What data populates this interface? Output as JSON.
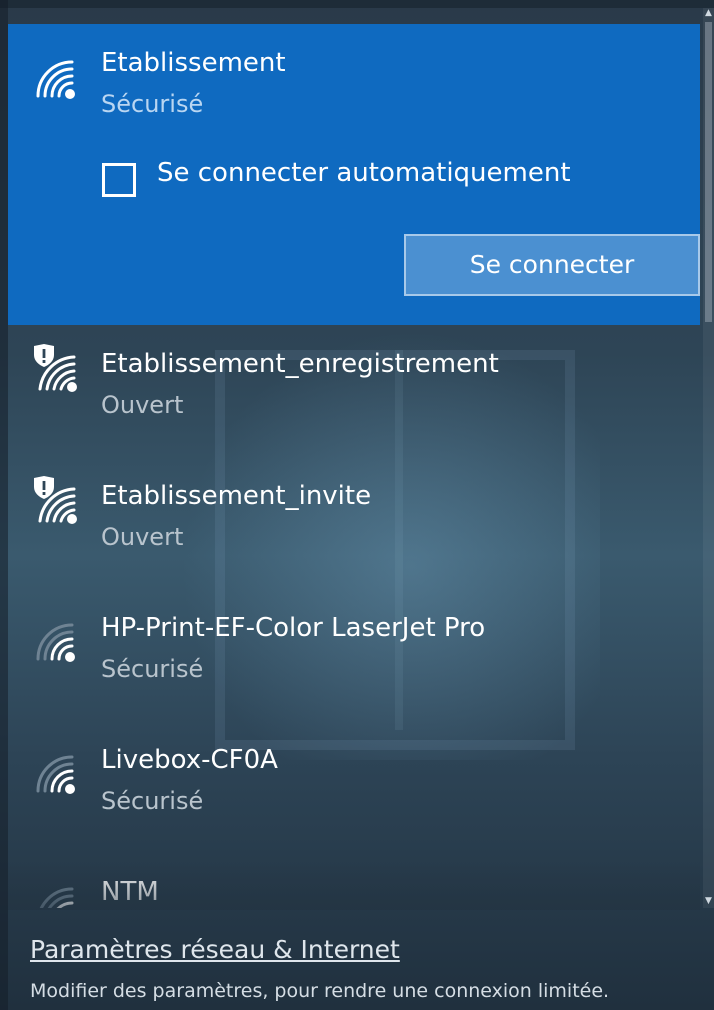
{
  "selected_network": {
    "name": "Etablissement",
    "status": "Sécurisé",
    "auto_connect_label": "Se connecter automatiquement",
    "auto_connect_checked": false,
    "connect_button": "Se connecter",
    "icon": "wifi-secured-icon"
  },
  "networks": [
    {
      "name": "Etablissement_enregistrement",
      "status": "Ouvert",
      "icon": "wifi-open-shield-icon"
    },
    {
      "name": "Etablissement_invite",
      "status": "Ouvert",
      "icon": "wifi-open-shield-icon"
    },
    {
      "name": "HP-Print-EF-Color LaserJet Pro",
      "status": "Sécurisé",
      "icon": "wifi-signal-icon"
    },
    {
      "name": "Livebox-CF0A",
      "status": "Sécurisé",
      "icon": "wifi-signal-icon"
    },
    {
      "name": "NTM",
      "status": "",
      "icon": "wifi-signal-icon"
    }
  ],
  "footer": {
    "link": "Paramètres réseau & Internet",
    "description": "Modifier des paramètres, pour rendre une connexion limitée."
  },
  "colors": {
    "selected_bg": "#0f6ac0",
    "button_bg": "#4b90d1",
    "panel_bg": "#2e4556"
  }
}
